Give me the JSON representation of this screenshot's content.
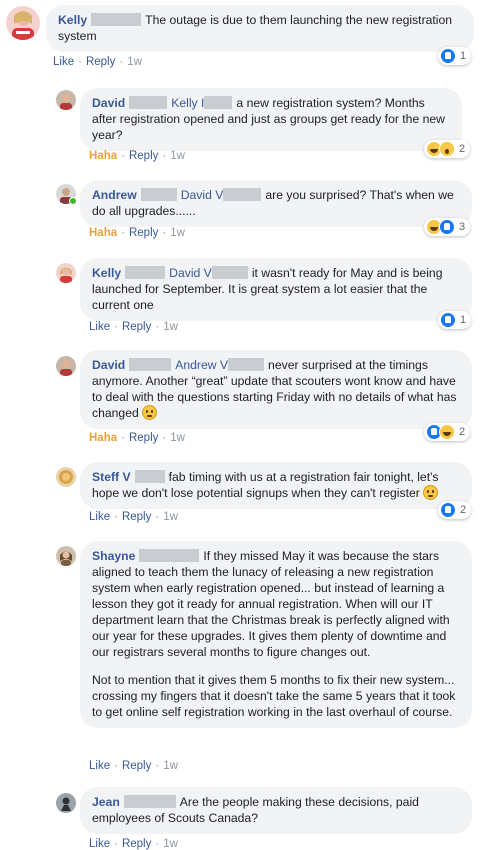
{
  "comments": [
    {
      "author": "Kelly",
      "text": "The outage is due to them launching the new registration system",
      "actions": {
        "like": "Like",
        "reply": "Reply",
        "time": "1w"
      },
      "reactions": {
        "types": [
          "like"
        ],
        "count": "1"
      }
    },
    {
      "author": "David",
      "mention": "Kelly I",
      "text": "a new registration system? Months after registration opened and just as groups get ready for the new year?",
      "actions": {
        "like": "Haha",
        "reply": "Reply",
        "time": "1w"
      },
      "reactions": {
        "types": [
          "haha",
          "wow"
        ],
        "count": "2"
      }
    },
    {
      "author": "Andrew",
      "mention": "David V",
      "text": "are you surprised? That's when we do all upgrades......",
      "actions": {
        "like": "Haha",
        "reply": "Reply",
        "time": "1w"
      },
      "reactions": {
        "types": [
          "haha",
          "like"
        ],
        "count": "3"
      }
    },
    {
      "author": "Kelly",
      "mention": "David V",
      "text": "it wasn't ready for May and is being launched for September. It is great system a lot easier that the current one",
      "actions": {
        "like": "Like",
        "reply": "Reply",
        "time": "1w"
      },
      "reactions": {
        "types": [
          "like"
        ],
        "count": "1"
      }
    },
    {
      "author": "David",
      "mention": "Andrew V",
      "text": "never surprised at the timings anymore. Another “great” update that scouters wont know and have to deal with the questions starting Friday with no details of what has changed",
      "actions": {
        "like": "Haha",
        "reply": "Reply",
        "time": "1w"
      },
      "reactions": {
        "types": [
          "like",
          "haha"
        ],
        "count": "2"
      }
    },
    {
      "author": "Steff V",
      "text": "fab timing with us at a registration fair tonight, let's hope we don't lose potential signups when they can't register",
      "actions": {
        "like": "Like",
        "reply": "Reply",
        "time": "1w"
      },
      "reactions": {
        "types": [
          "like"
        ],
        "count": "2"
      }
    },
    {
      "author": "Shayne",
      "text": "If they missed May it was because the stars aligned to teach them the lunacy of releasing a new registration system when early registration opened... but instead of learning a lesson they got it ready for annual registration. When will our IT department learn that the Christmas break is perfectly aligned with our year for these upgrades. It gives them plenty of downtime and our registrars several months to figure changes out.",
      "text2": "Not to mention that it gives them 5 months to fix their new system... crossing my fingers that it doesn't take the same 5 years that it took to get online self registration working in the last overhaul of course.",
      "actions": {
        "like": "Like",
        "reply": "Reply",
        "time": "1w"
      }
    },
    {
      "author": "Jean",
      "text": "Are the people making these decisions, paid employees of Scouts Canada?",
      "actions": {
        "like": "Like",
        "reply": "Reply",
        "time": "1w"
      }
    }
  ],
  "colors": {
    "link": "#385898",
    "bubble": "#f2f3f5",
    "haha": "#e9a13b",
    "like_blue": "#1877f2"
  }
}
